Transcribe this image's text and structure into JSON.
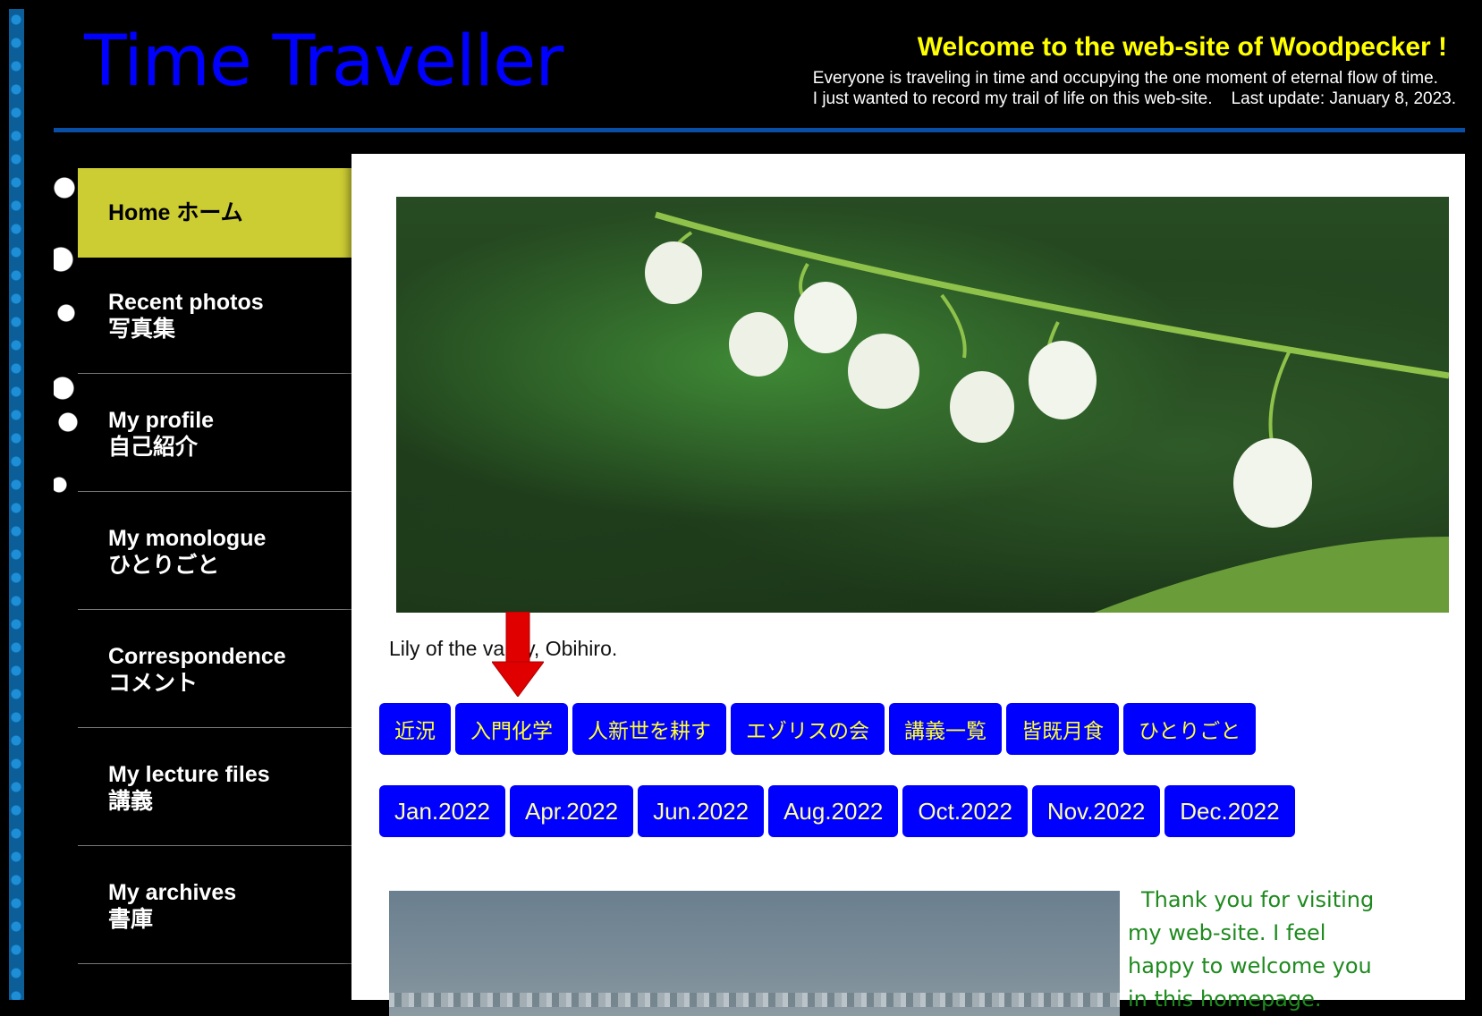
{
  "header": {
    "title": "Time Traveller",
    "welcome": "Welcome to the web-site of Woodpecker !",
    "tagline_line1": "Everyone is traveling in time and occupying the one moment of eternal flow of time.",
    "tagline_line2": "I just wanted to record my trail of life on this web-site.    Last update: January 8, 2023."
  },
  "sidebar": {
    "items": [
      {
        "en": "Home ホーム",
        "ja": ""
      },
      {
        "en": "Recent photos",
        "ja": "写真集"
      },
      {
        "en": "My profile",
        "ja": "自己紹介"
      },
      {
        "en": "My monologue",
        "ja": "ひとりごと"
      },
      {
        "en": "Correspondence",
        "ja": "コメント"
      },
      {
        "en": "My lecture files",
        "ja": "講義"
      },
      {
        "en": "My archives",
        "ja": "書庫"
      }
    ]
  },
  "main": {
    "caption": "Lily of the valley, Obihiro.",
    "topic_buttons": [
      "近況",
      "入門化学",
      "人新世を耕す",
      "エゾリスの会",
      "講義一覧",
      "皆既月食",
      "ひとりごと"
    ],
    "month_buttons": [
      "Jan.2022",
      "Apr.2022",
      "Jun.2022",
      "Aug.2022",
      "Oct.2022",
      "Nov.2022",
      "Dec.2022"
    ],
    "welcome_message": "Thank you for visiting my web-site. I feel happy to welcome you in this homepage."
  },
  "colors": {
    "title": "#0000ff",
    "welcome": "#ffff00",
    "active_nav": "#cccc33",
    "button_bg": "#0000ff",
    "button_text": "#ffff33",
    "message_text": "#1e8a1e",
    "annotation_arrow": "#e00000"
  }
}
